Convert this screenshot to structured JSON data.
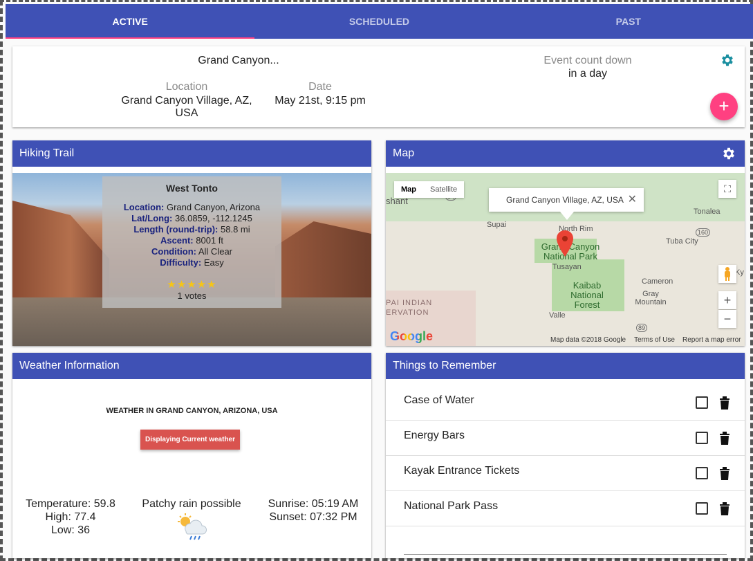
{
  "tabs": [
    {
      "label": "ACTIVE"
    },
    {
      "label": "SCHEDULED"
    },
    {
      "label": "PAST"
    }
  ],
  "event": {
    "title": "Grand Canyon...",
    "location_label": "Location",
    "location_value": "Grand Canyon Village, AZ, USA",
    "date_label": "Date",
    "date_value": "May 21st, 9:15 pm",
    "countdown_label": "Event count down",
    "countdown_value": "in a day",
    "fab_label": "+"
  },
  "hiking": {
    "header": "Hiking Trail",
    "trail_name": "West Tonto",
    "details": [
      {
        "key": "Location:",
        "value": "Grand Canyon, Arizona"
      },
      {
        "key": "Lat/Long:",
        "value": "36.0859, -112.1245"
      },
      {
        "key": "Length (round-trip):",
        "value": "58.8 mi"
      },
      {
        "key": "Ascent:",
        "value": "8001 ft"
      },
      {
        "key": "Condition:",
        "value": "All Clear"
      },
      {
        "key": "Difficulty:",
        "value": "Easy"
      }
    ],
    "rating_stars": "★★★★★",
    "votes": "1 votes"
  },
  "map": {
    "header": "Map",
    "type_map": "Map",
    "type_satellite": "Satellite",
    "info_text": "Grand Canyon Village, AZ, USA",
    "info_close": "✕",
    "zoom_in": "+",
    "zoom_out": "−",
    "labels": {
      "shant": "shant",
      "supai": "Supai",
      "north_rim": "North Rim",
      "gcnp": "Grand Canyon National Park",
      "tusayan": "Tusayan",
      "kaibab": "Kaibab National Forest",
      "tonalea": "Tonalea",
      "tuba_city": "Tuba City",
      "cameron": "Cameron",
      "gray_mountain": "Gray Mountain",
      "valle": "Valle",
      "pai_indian": "PAI INDIAN",
      "ervation": "ERVATION",
      "k": "Ky",
      "r160": "160",
      "r89": "89",
      "r64": "64"
    },
    "google": "Google",
    "map_data": "Map data ©2018 Google",
    "terms": "Terms of Use",
    "report": "Report a map error"
  },
  "weather": {
    "header": "Weather Information",
    "title": "WEATHER IN GRAND CANYON, ARIZONA, USA",
    "badge": "Displaying Current weather",
    "temperature": "Temperature: 59.8",
    "high": "High: 77.4",
    "low": "Low: 36",
    "condition": "Patchy rain possible",
    "sunrise": "Sunrise: 05:19 AM",
    "sunset": "Sunset: 07:32 PM"
  },
  "remember": {
    "header": "Things to Remember",
    "items": [
      {
        "label": "Case of Water"
      },
      {
        "label": "Energy Bars"
      },
      {
        "label": "Kayak Entrance Tickets"
      },
      {
        "label": "National Park Pass"
      }
    ]
  },
  "colors": {
    "primary": "#3f51b5",
    "accent": "#ff4081",
    "teal": "#1a8fa0",
    "badge": "#d9534f"
  }
}
